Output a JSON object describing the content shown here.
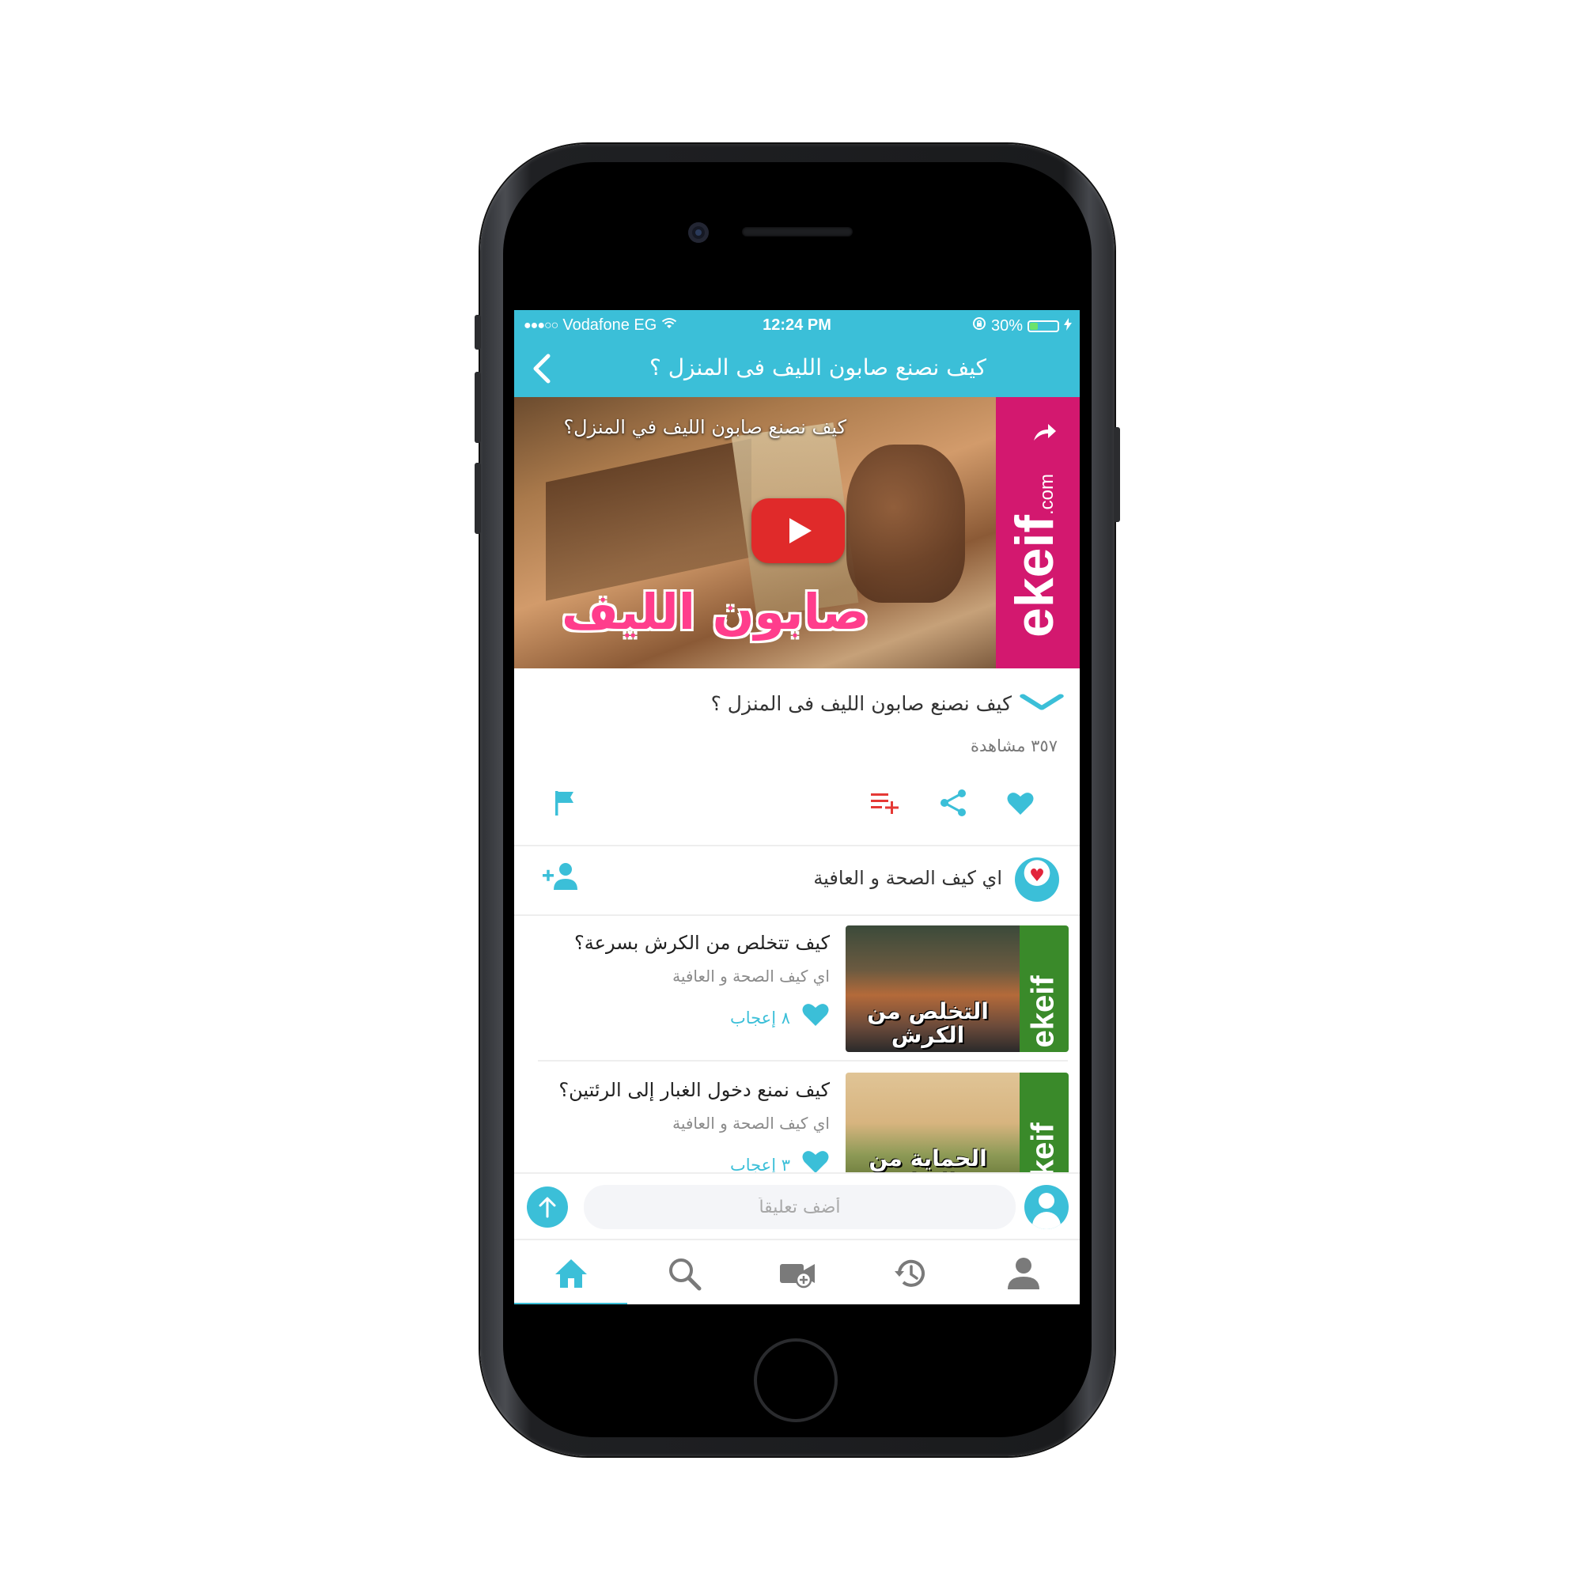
{
  "status_bar": {
    "signal": "●●●○○",
    "carrier": "Vodafone EG",
    "time": "12:24 PM",
    "battery_percent": "30%",
    "battery_level": 0.3
  },
  "header": {
    "title": "كيف نصنع صابون الليف فى المنزل ؟"
  },
  "video": {
    "overlay_title": "كيف نصنع صابون الليف في المنزل؟",
    "big_title": "صابون الليف",
    "brand": "ekeif",
    "brand_suffix": ".com"
  },
  "video_info": {
    "title": "كيف نصنع صابون الليف فى المنزل ؟",
    "views": "٣٥٧ مشاهدة"
  },
  "channel": {
    "name": "اي كيف الصحة و العافية"
  },
  "related": [
    {
      "title": "كيف تتخلص من الكرش بسرعة؟",
      "channel": "اي كيف الصحة و العافية",
      "likes": "٨ إعجاب",
      "thumb_caption": "التخلص من الكرش"
    },
    {
      "title": "كيف نمنع دخول الغبار إلى الرئتين؟",
      "channel": "اي كيف الصحة و العافية",
      "likes": "٣ إعجاب",
      "thumb_caption": "الحماية من الغبار"
    }
  ],
  "comment": {
    "placeholder": "أضف تعليقاً"
  },
  "colors": {
    "accent": "#3bbfd8",
    "brand_pink": "#d3186f",
    "play_red": "#e02a2a",
    "playlist_red": "#e53935"
  },
  "icons": [
    "back-chevron-icon",
    "play-icon",
    "chevron-down-icon",
    "heart-icon",
    "share-icon",
    "playlist-add-icon",
    "flag-icon",
    "add-user-icon",
    "send-icon",
    "home-icon",
    "search-icon",
    "video-add-icon",
    "history-icon",
    "profile-icon"
  ]
}
